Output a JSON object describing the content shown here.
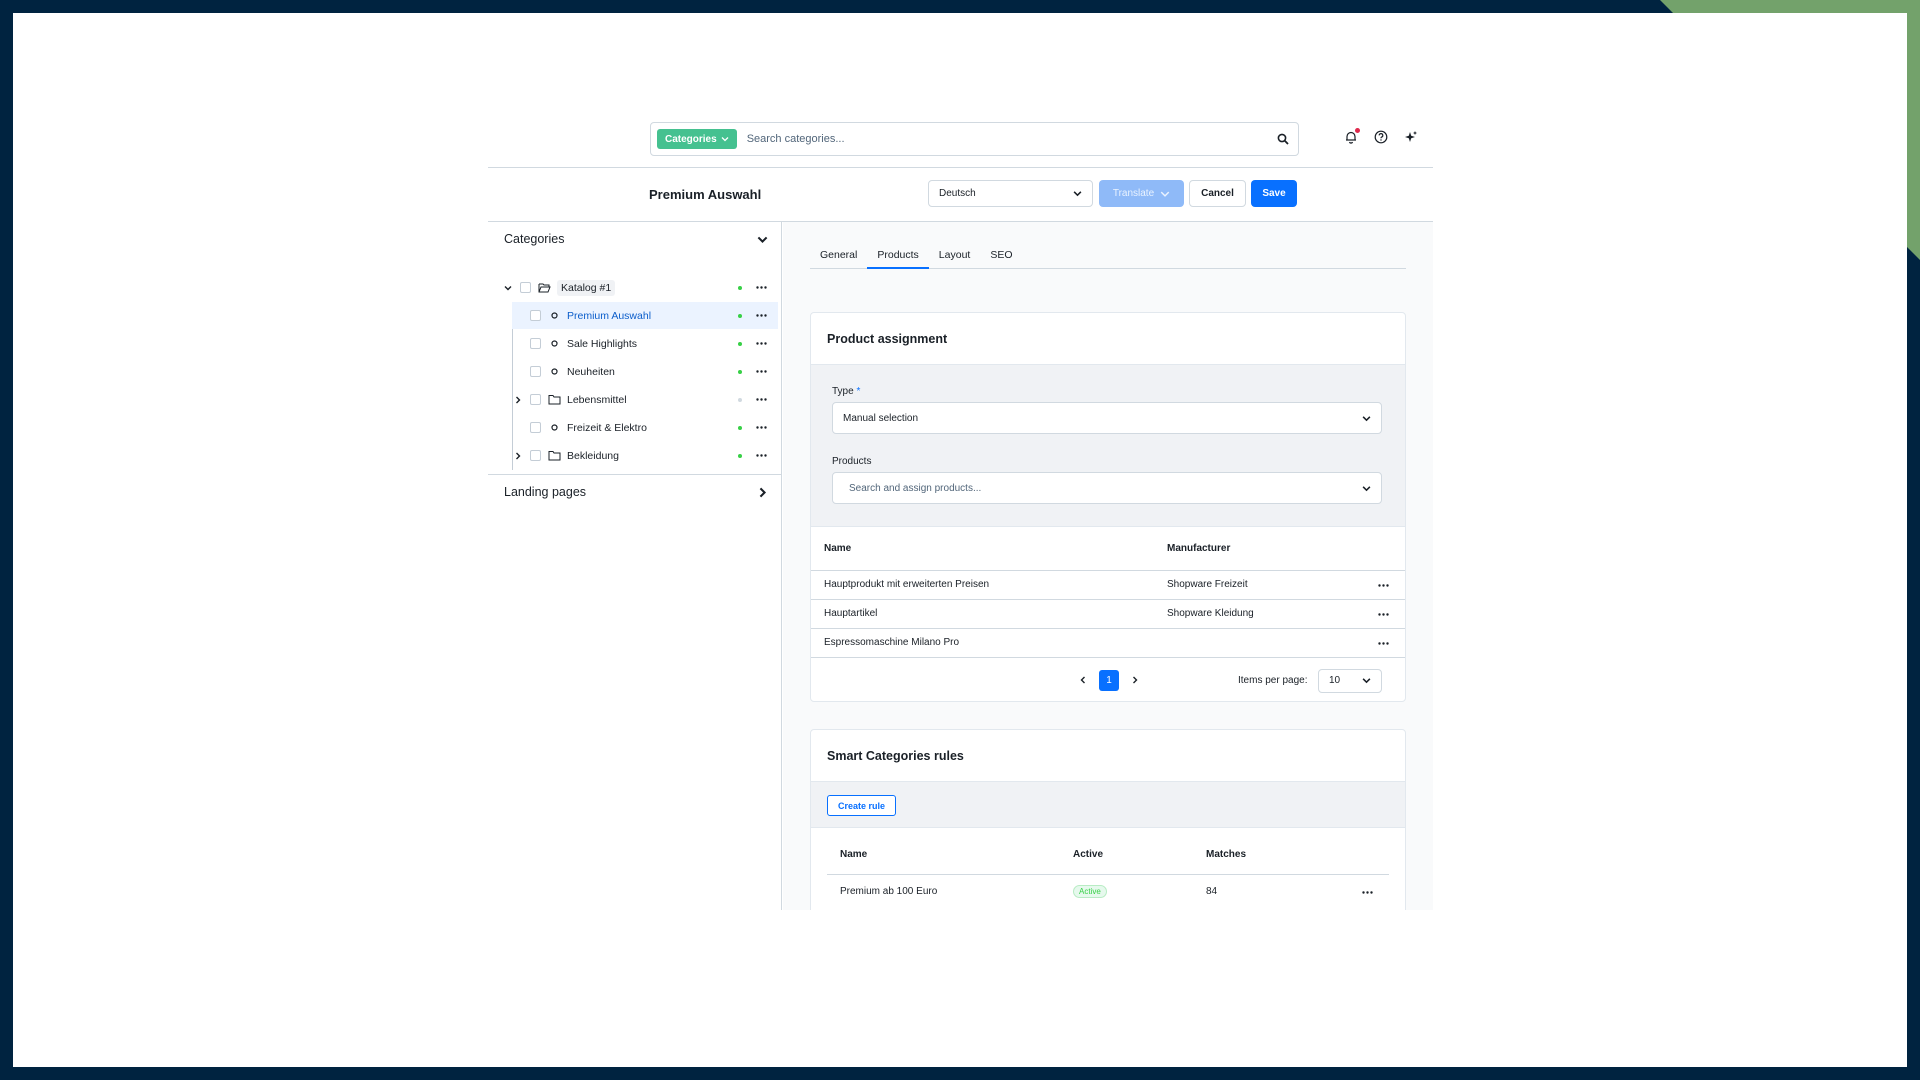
{
  "colors": {
    "accent": "#0870ff",
    "categories_pill": "#45c190",
    "active_dot": "#37d046"
  },
  "search": {
    "type_label": "Categories",
    "placeholder": "Search categories..."
  },
  "top_icons": [
    "bell-icon",
    "help-icon",
    "sparkle-icon"
  ],
  "header": {
    "title": "Premium Auswahl",
    "language": "Deutsch",
    "translate_label": "Translate",
    "cancel_label": "Cancel",
    "save_label": "Save"
  },
  "tree": {
    "categories_title": "Categories",
    "landing_title": "Landing pages",
    "root": {
      "label": "Katalog #1"
    },
    "items": [
      {
        "label": "Premium Auswahl",
        "selected": true,
        "active": true
      },
      {
        "label": "Sale Highlights",
        "active": true
      },
      {
        "label": "Neuheiten",
        "active": true
      },
      {
        "label": "Lebensmittel",
        "folder": true,
        "active": false
      },
      {
        "label": "Freizeit & Elektro",
        "active": true
      },
      {
        "label": "Bekleidung",
        "folder": true,
        "active": true
      }
    ]
  },
  "tabs": [
    "General",
    "Products",
    "Layout",
    "SEO"
  ],
  "active_tab": "Products",
  "assignment": {
    "title": "Product assignment",
    "type_label": "Type",
    "type_required": "*",
    "type_value": "Manual selection",
    "products_label": "Products",
    "products_placeholder": "Search and assign products...",
    "columns": [
      "Name",
      "Manufacturer"
    ],
    "rows": [
      {
        "name": "Hauptprodukt mit erweiterten Preisen",
        "manufacturer": "Shopware Freizeit"
      },
      {
        "name": "Hauptartikel",
        "manufacturer": "Shopware Kleidung"
      },
      {
        "name": "Espressomaschine Milano Pro",
        "manufacturer": ""
      }
    ],
    "current_page": "1",
    "items_per_page_label": "Items per page:",
    "items_per_page": "10"
  },
  "smart": {
    "title": "Smart Categories rules",
    "create_label": "Create rule",
    "columns": [
      "Name",
      "Active",
      "Matches"
    ],
    "rows": [
      {
        "name": "Premium ab 100 Euro",
        "active": "Active",
        "matches": "84"
      }
    ]
  }
}
